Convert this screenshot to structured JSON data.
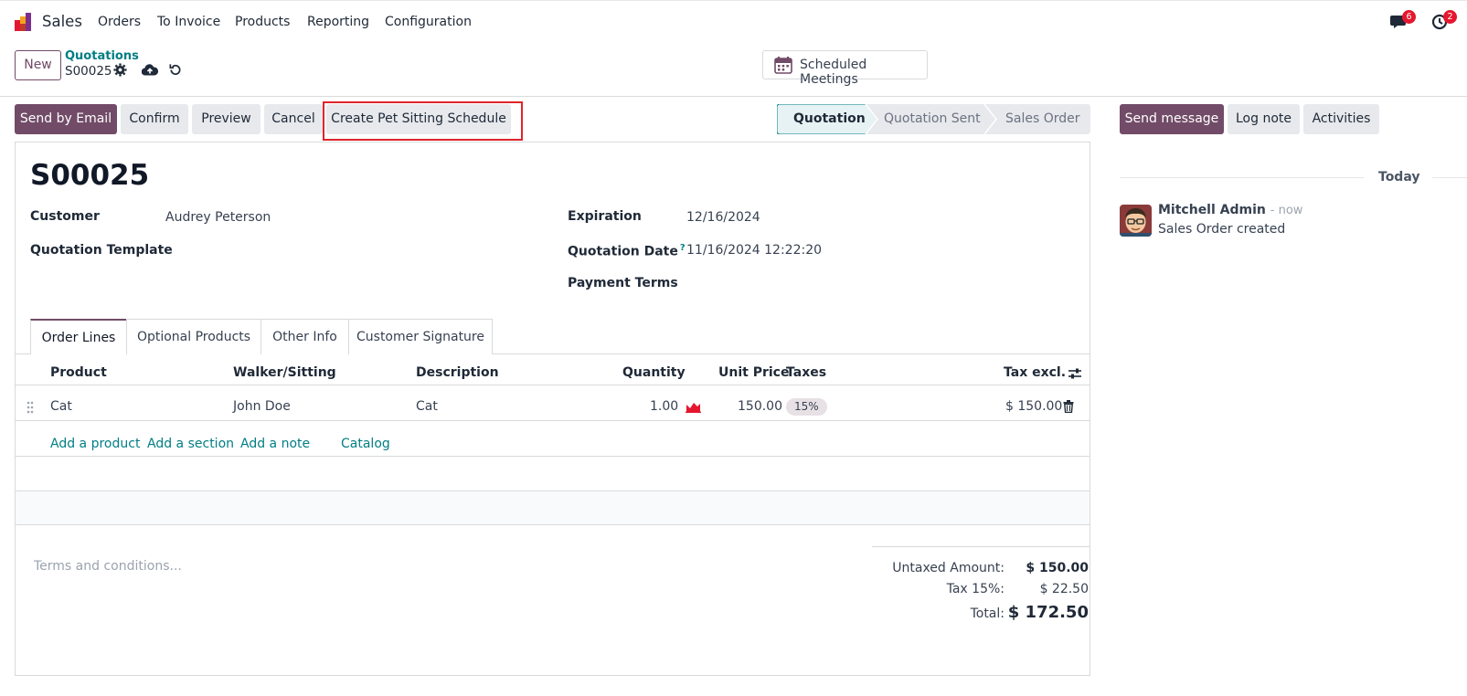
{
  "nav": {
    "app_name": "Sales",
    "menu": [
      "Orders",
      "To Invoice",
      "Products",
      "Reporting",
      "Configuration"
    ],
    "messages_badge": "6",
    "activities_badge": "2"
  },
  "control_panel": {
    "new_label": "New",
    "breadcrumb_parent": "Quotations",
    "breadcrumb_current": "S00025",
    "meetings_label": "Scheduled Meetings"
  },
  "actions": {
    "send_email": "Send by Email",
    "confirm": "Confirm",
    "preview": "Preview",
    "cancel": "Cancel",
    "pet_schedule": "Create Pet Sitting Schedule"
  },
  "status": {
    "stages": [
      "Quotation",
      "Quotation Sent",
      "Sales Order"
    ],
    "active": "Quotation"
  },
  "form": {
    "name": "S00025",
    "customer_label": "Customer",
    "customer_value": "Audrey Peterson",
    "template_label": "Quotation Template",
    "expiration_label": "Expiration",
    "expiration_value": "12/16/2024",
    "date_label": "Quotation Date",
    "date_help": "?",
    "date_value": "11/16/2024 12:22:20",
    "payment_terms_label": "Payment Terms"
  },
  "tabs": [
    "Order Lines",
    "Optional Products",
    "Other Info",
    "Customer Signature"
  ],
  "table": {
    "headers": {
      "product": "Product",
      "walker": "Walker/Sitting",
      "description": "Description",
      "quantity": "Quantity",
      "unit_price": "Unit Price",
      "taxes": "Taxes",
      "tax_excl": "Tax excl."
    },
    "rows": [
      {
        "product": "Cat",
        "walker": "John Doe",
        "description": "Cat",
        "quantity": "1.00",
        "unit_price": "150.00",
        "taxes": "15%",
        "tax_excl": "$ 150.00"
      }
    ],
    "add_links": {
      "product": "Add a product",
      "section": "Add a section",
      "note": "Add a note",
      "catalog": "Catalog"
    }
  },
  "totals": {
    "terms_placeholder": "Terms and conditions...",
    "untaxed_label": "Untaxed Amount:",
    "untaxed_value": "$ 150.00",
    "tax_label": "Tax 15%:",
    "tax_value": "$ 22.50",
    "total_label": "Total:",
    "total_value": "$ 172.50"
  },
  "chatter": {
    "send_message": "Send message",
    "log_note": "Log note",
    "activities": "Activities",
    "day": "Today",
    "author": "Mitchell Admin",
    "time": "- now",
    "body": "Sales Order created"
  },
  "colors": {
    "brand": "#714b67",
    "link": "#017e84",
    "badge": "#e4172f",
    "highlight": "#e0242a"
  }
}
